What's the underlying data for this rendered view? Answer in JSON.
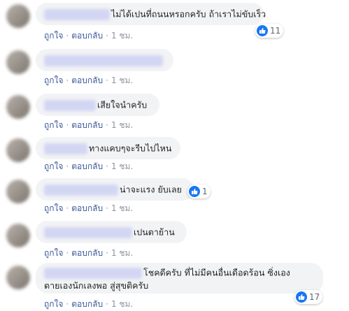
{
  "actions": {
    "like": "ถูกใจ",
    "reply": "ตอบกลับ",
    "dot": "·",
    "time": "1 ชม."
  },
  "comments": [
    {
      "text": "ไม่ได้เปนที่ถนนหรอกครับ ถ้าเราไม่ขับเร็ว",
      "likes": "11"
    },
    {
      "text": "",
      "likes": ""
    },
    {
      "text": "เสียใจนำครับ",
      "likes": ""
    },
    {
      "text": "ทางแคบๆจะรีบไปไหน",
      "likes": ""
    },
    {
      "text": "น่าจะแรง ยับเลย",
      "likes": "1"
    },
    {
      "text": "เปนตาย้าน",
      "likes": ""
    },
    {
      "text_line1": "โชคดีครับ ที่ไม่มีคนอื่นเดือดร้อน ซิ่งเอง",
      "text_line2": "ตายเองนักเลงพอ สู่สุขติครับ",
      "likes": "17"
    }
  ],
  "icons": {
    "like": "thumbs-up-icon"
  },
  "colors": {
    "bubble": "#f2f3f5",
    "like_blue": "#1877f2",
    "link": "#385898",
    "blurred_name": "#d3d6f3"
  }
}
